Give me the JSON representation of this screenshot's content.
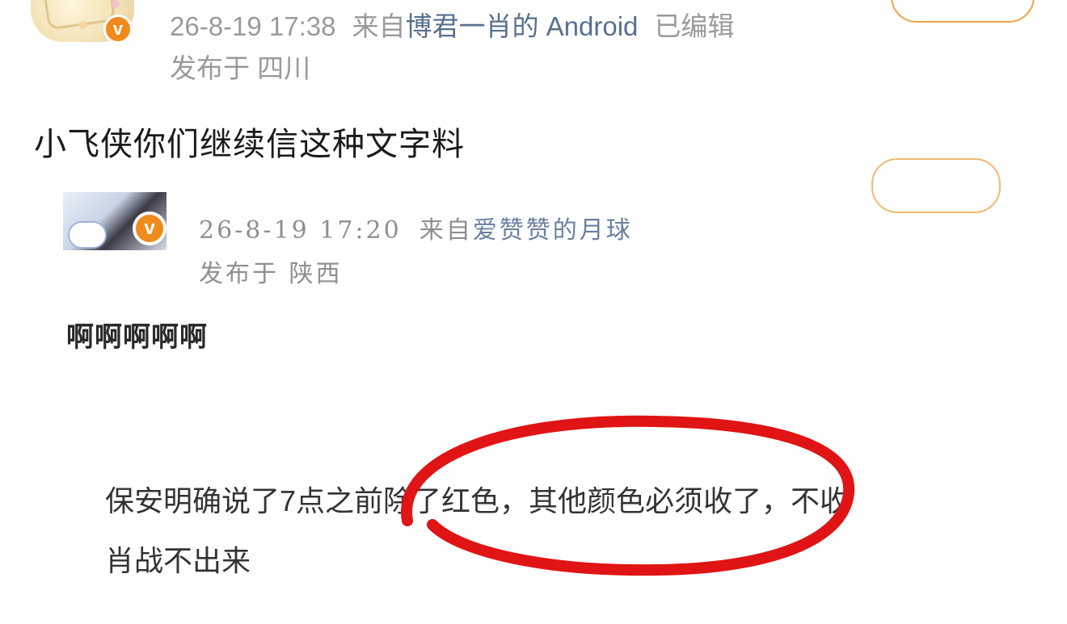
{
  "top_post": {
    "timestamp": "26-8-19 17:38",
    "from_label": "来自",
    "source": "博君一肖的 Android",
    "edited": "已编辑",
    "location": "发布于 四川",
    "text": "小飞侠你们继续信这种文字料",
    "verified_badge": "v"
  },
  "quoted_post": {
    "timestamp": "26-8-19 17:20",
    "from_label": "来自",
    "source": "爱赞赞的月球",
    "location": "发布于 陕西",
    "text": "啊啊啊啊啊",
    "verified_badge": "v"
  },
  "notice": {
    "line1": "保安明确说了7点之前除了红色，其他颜色必须收了，不收",
    "line2": "肖战不出来"
  },
  "colors": {
    "meta_grey": "#9a9a9a",
    "source_blue": "#58708f",
    "verified_orange": "#f08a1c",
    "highlight_red": "#e01414",
    "follow_border": "#f1a34a"
  }
}
